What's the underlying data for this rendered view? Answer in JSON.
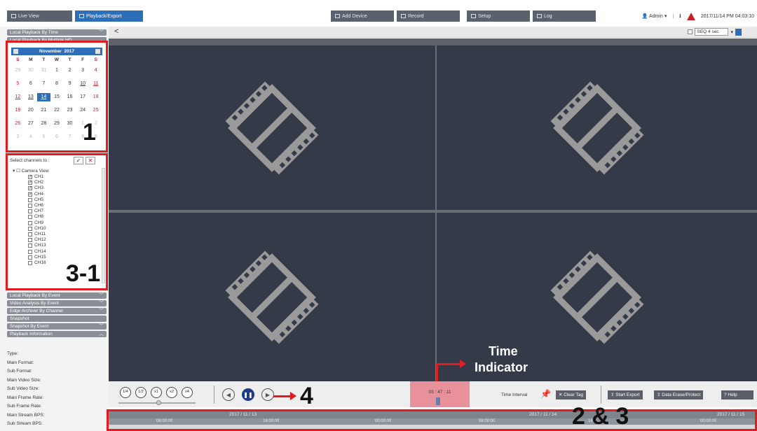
{
  "topbar": {
    "tabs": [
      {
        "label": "Live View",
        "icon": "monitor-icon"
      },
      {
        "label": "Playback/Export",
        "icon": "playback-icon"
      },
      {
        "label": "Add Device",
        "icon": "add-device-icon"
      },
      {
        "label": "Record",
        "icon": "record-icon"
      },
      {
        "label": "Setup",
        "icon": "gear-icon"
      },
      {
        "label": "Log",
        "icon": "log-icon"
      }
    ],
    "user": "Admin",
    "datetime": "2017/11/14 PM 04:03:10"
  },
  "toolbar": {
    "back": "<",
    "seq_label": "SEQ 4 sec"
  },
  "sidebar": {
    "sections_top": [
      "Local Playback By Time",
      "Local Playback By Multiple HD..."
    ],
    "calendar": {
      "month": "November",
      "year": "2017",
      "weekdays": [
        "S",
        "M",
        "T",
        "W",
        "T",
        "F",
        "S"
      ],
      "weeks": [
        [
          "29",
          "30",
          "31",
          "1",
          "2",
          "3",
          "4"
        ],
        [
          "5",
          "6",
          "7",
          "8",
          "9",
          "10",
          "11"
        ],
        [
          "12",
          "13",
          "14",
          "15",
          "16",
          "17",
          "18"
        ],
        [
          "19",
          "20",
          "21",
          "22",
          "23",
          "24",
          "25"
        ],
        [
          "26",
          "27",
          "28",
          "29",
          "30",
          "1",
          "2"
        ],
        [
          "3",
          "4",
          "5",
          "6",
          "7",
          "8",
          "9"
        ]
      ],
      "selected": "14"
    },
    "channels": {
      "title": "Select channels to :",
      "ok": "✓",
      "cancel": "✕",
      "root": "Camera View",
      "items": [
        {
          "label": "CH1",
          "checked": true
        },
        {
          "label": "CH2",
          "checked": true
        },
        {
          "label": "CH3",
          "checked": true
        },
        {
          "label": "CH4",
          "checked": true
        },
        {
          "label": "CH5",
          "checked": false
        },
        {
          "label": "CH6",
          "checked": false
        },
        {
          "label": "CH7",
          "checked": false
        },
        {
          "label": "CH8",
          "checked": false
        },
        {
          "label": "CH9",
          "checked": false
        },
        {
          "label": "CH10",
          "checked": false
        },
        {
          "label": "CH11",
          "checked": false
        },
        {
          "label": "CH12",
          "checked": false
        },
        {
          "label": "CH13",
          "checked": false
        },
        {
          "label": "CH14",
          "checked": false
        },
        {
          "label": "CH15",
          "checked": false
        },
        {
          "label": "CH16",
          "checked": false
        }
      ]
    },
    "sections_bottom": [
      "Local Playback By Event",
      "Video Analysis By Event",
      "Edge Archiver By Channel",
      "Snapshot",
      "Snapshot By Event",
      "Playback Information"
    ],
    "info_fields": [
      "Type:",
      "Main Format:",
      "Sub Format:",
      "Main Video Size:",
      "Sub Video Size:",
      "Main Frame Rate:",
      "Sub Frame Rate:",
      "Main Stream BPS:",
      "Sub Stream BPS:"
    ]
  },
  "controls": {
    "speeds": [
      "1/4",
      "1/2",
      "x1",
      "x2",
      "x4"
    ],
    "time": "03 : 47 : 11",
    "time_interval": "Time Interval",
    "clear_tag": "Clear Tag",
    "start_export": "Start Export",
    "data_erase": "Data Erase/Protect",
    "help": "Help"
  },
  "timeline": {
    "dates": [
      "2017 / 11 / 13",
      "2017 / 11 / 14",
      "2017 / 11 / 15"
    ],
    "times": [
      "08:00:00",
      "16:00:00",
      "00:00:00",
      "08:00:00",
      "16:0",
      "00:00:00"
    ]
  },
  "annotations": {
    "a1": "1",
    "a31": "3-1",
    "a4": "4",
    "a23": "2 & 3",
    "time_indicator_1": "Time",
    "time_indicator_2": "Indicator"
  },
  "colors": {
    "accent": "#2c6fb8",
    "highlight": "#e11b22",
    "video_bg": "#343a48"
  }
}
